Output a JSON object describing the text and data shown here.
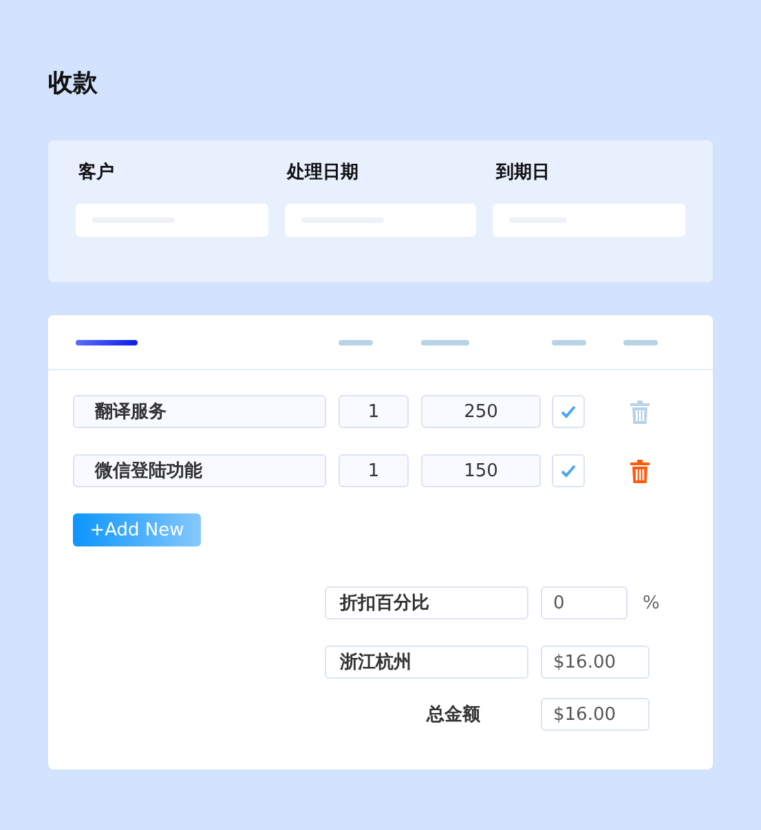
{
  "title": "收款",
  "header_fields": [
    {
      "label": "客户"
    },
    {
      "label": "处理日期"
    },
    {
      "label": "到期日"
    }
  ],
  "items": [
    {
      "name": "翻译服务",
      "quantity": "1",
      "price": "250",
      "checked": true,
      "delete_active": false
    },
    {
      "name": "微信登陆功能",
      "quantity": "1",
      "price": "150",
      "checked": true,
      "delete_active": true
    }
  ],
  "add_button": "+Add New",
  "discount": {
    "label": "折扣百分比",
    "value": "0",
    "unit": "%"
  },
  "tax": {
    "label": "浙江杭州",
    "value": "$16.00"
  },
  "total": {
    "label": "总金额",
    "value": "$16.00"
  }
}
